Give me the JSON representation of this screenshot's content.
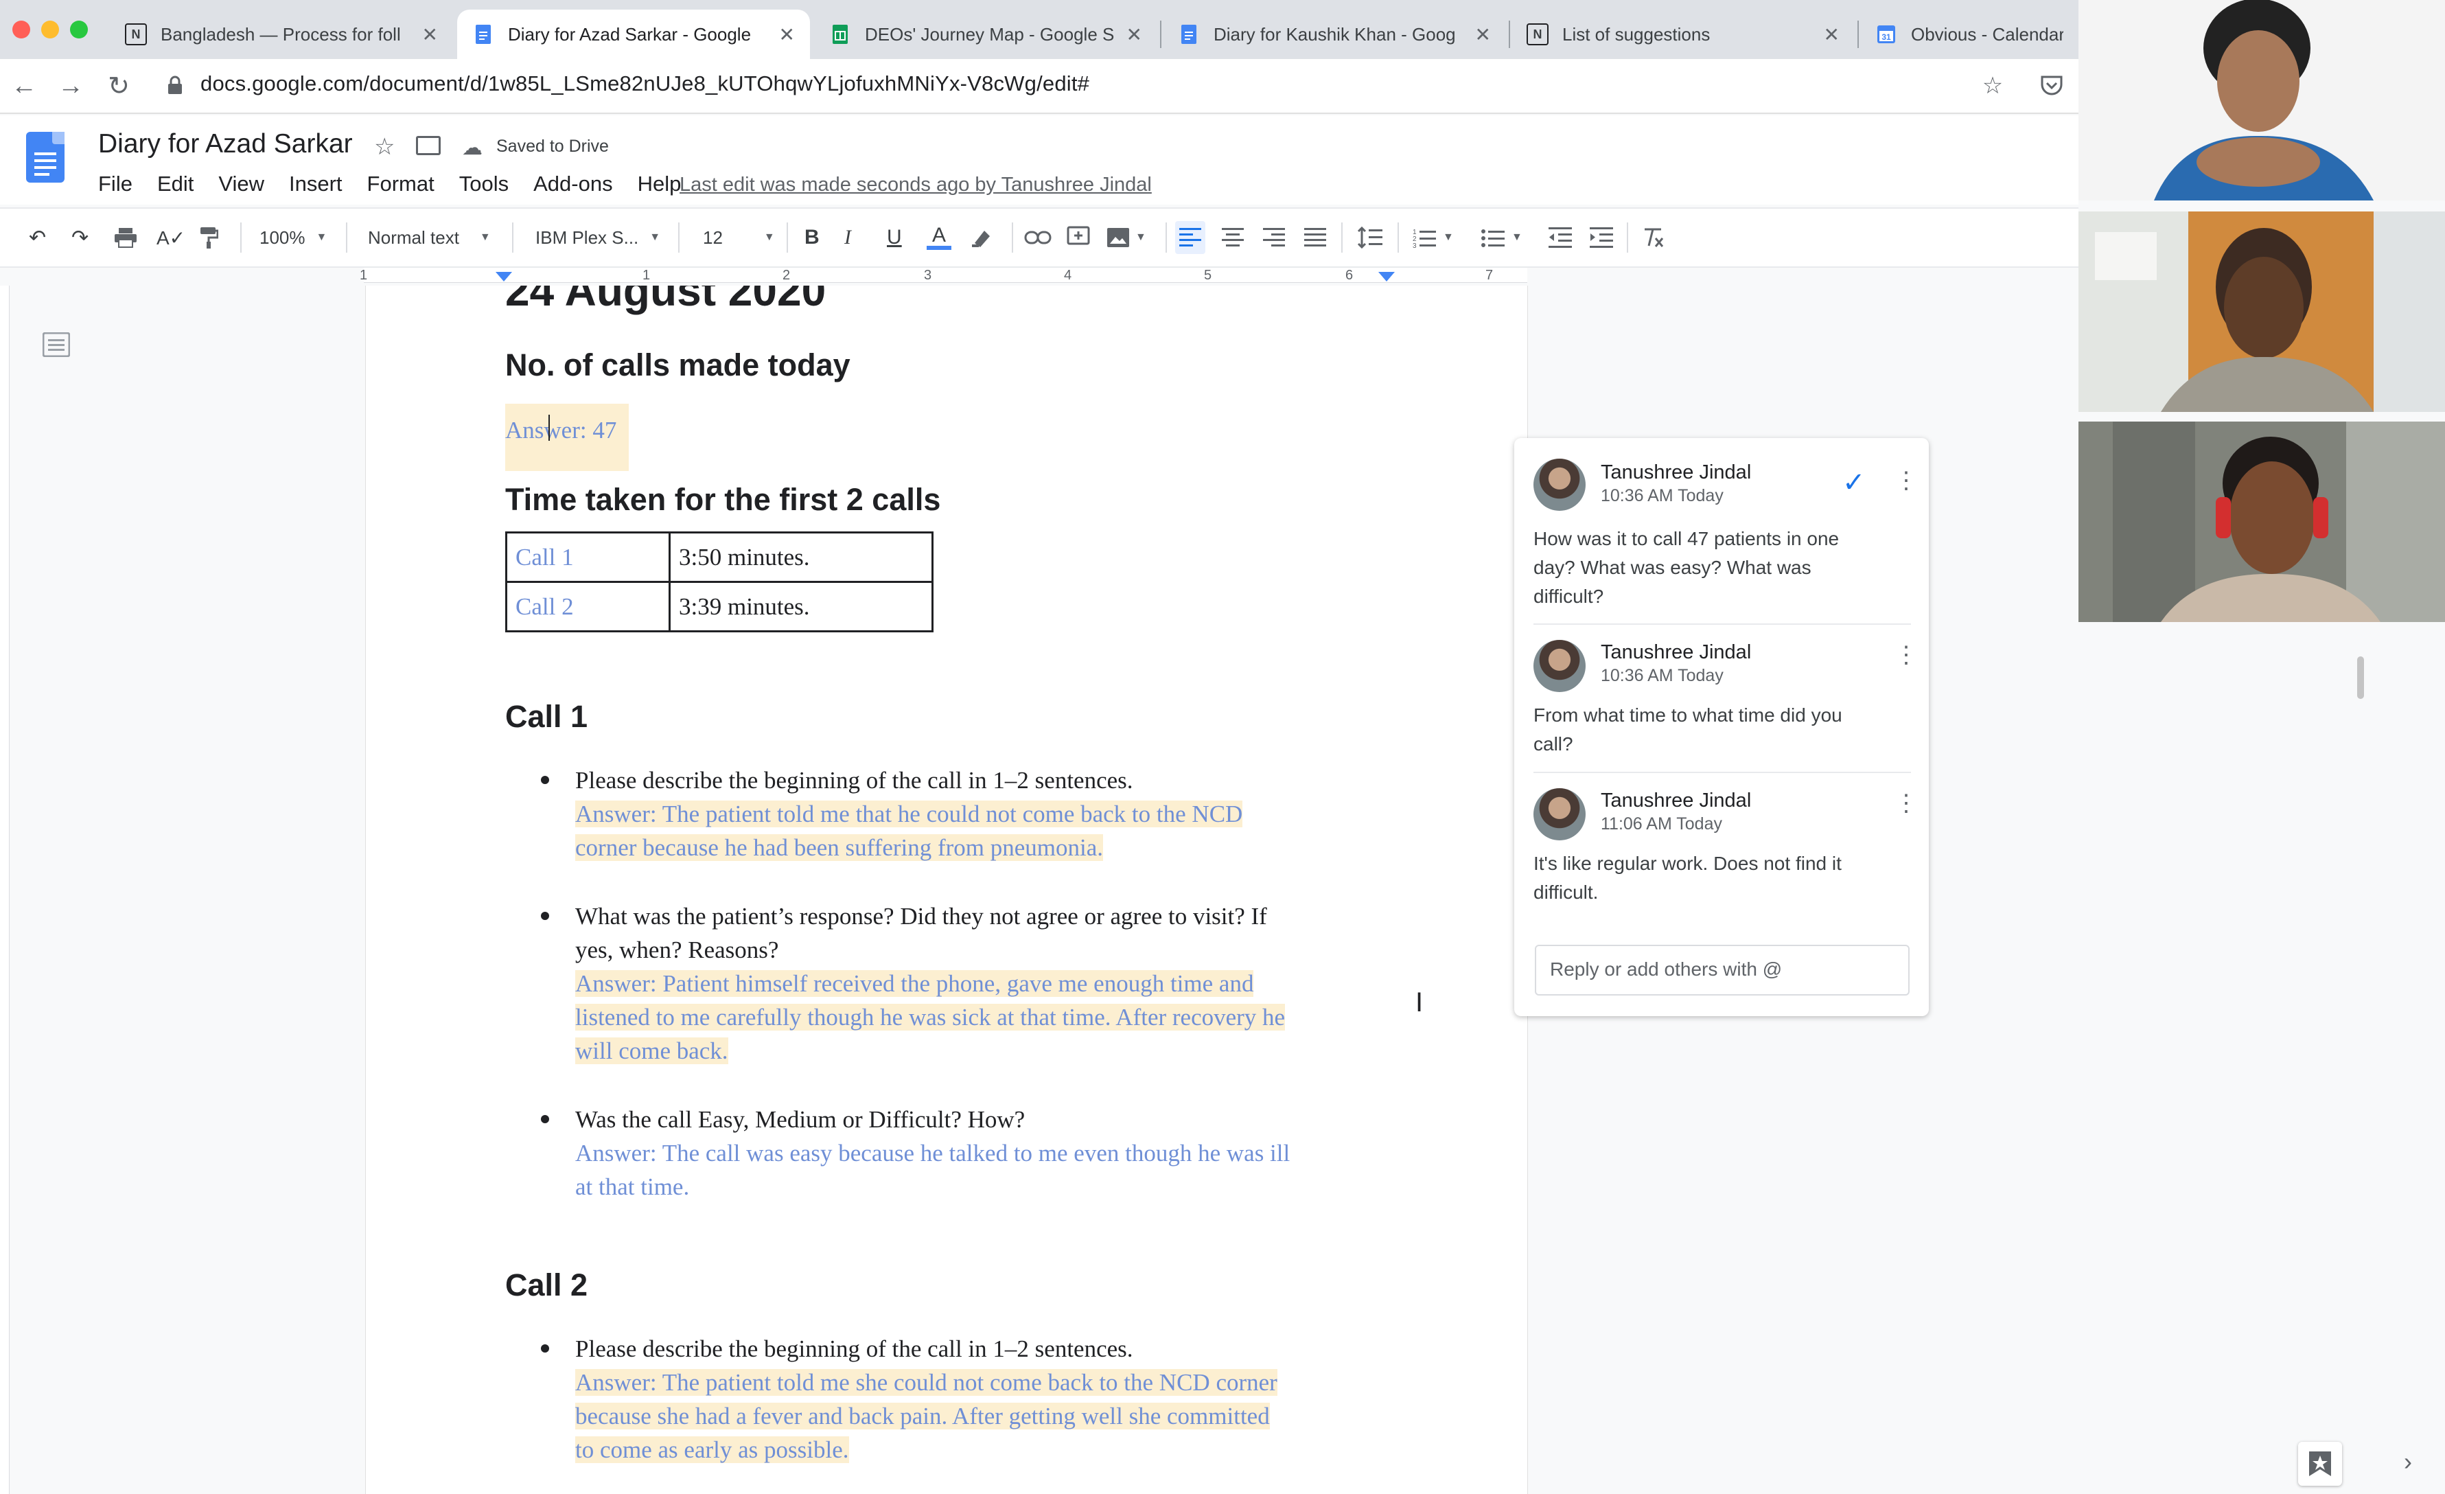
{
  "browser": {
    "tabs": [
      {
        "icon": "notion-icon",
        "title": "Bangladesh — Process for foll",
        "active": false
      },
      {
        "icon": "docs-icon",
        "title": "Diary for Azad Sarkar - Google",
        "active": true
      },
      {
        "icon": "sheets-icon",
        "title": "DEOs' Journey Map - Google S",
        "active": false
      },
      {
        "icon": "docs-icon",
        "title": "Diary for Kaushik Khan - Goog",
        "active": false
      },
      {
        "icon": "notion-icon",
        "title": "List of suggestions",
        "active": false
      },
      {
        "icon": "calendar-icon",
        "title": "Obvious - Calendar",
        "active": false
      }
    ],
    "close_glyph": "✕",
    "url": "docs.google.com/document/d/1w85L_LSme82nUJe8_kUTOhqwYLjofuxhMNiYx-V8cWg/edit#"
  },
  "docs": {
    "title": "Diary for Azad Sarkar",
    "saved_status": "Saved to Drive",
    "menu": [
      "File",
      "Edit",
      "View",
      "Insert",
      "Format",
      "Tools",
      "Add-ons",
      "Help"
    ],
    "last_edit": "Last edit was made seconds ago by Tanushree Jindal",
    "toolbar": {
      "zoom": "100%",
      "style": "Normal text",
      "font": "IBM Plex S...",
      "size": "12"
    },
    "ruler_numbers": [
      "1",
      "1",
      "2",
      "3",
      "4",
      "5",
      "6",
      "7"
    ]
  },
  "document": {
    "date_heading": "24 August 2020",
    "calls_heading": "No. of calls made today",
    "calls_answer": "Answer: 47",
    "time_heading": "Time taken for the first 2 calls",
    "time_table": [
      [
        "Call 1",
        "3:50 minutes."
      ],
      [
        "Call 2",
        "3:39 minutes."
      ]
    ],
    "call1": {
      "heading": "Call 1",
      "items": [
        {
          "q": "Please describe the beginning of the call in 1–2 sentences.",
          "a": [
            " Answer: The patient told me that he could not come back to the NCD",
            "corner because he had been suffering from pneumonia."
          ]
        },
        {
          "q": [
            "What was the patient’s response? Did they not agree or agree to visit? If",
            "yes, when? Reasons?"
          ],
          "a": [
            "Answer: Patient himself received the phone, gave me enough time and",
            "listened to me carefully though he was sick at that time. After recovery he",
            "will come back."
          ]
        },
        {
          "q": "Was the call Easy, Medium or Difficult? How?",
          "a": [
            "Answer: The call was easy because he talked to me even though he was ill",
            "at that time."
          ]
        }
      ]
    },
    "call2": {
      "heading": "Call 2",
      "items": [
        {
          "q": "Please describe the beginning of the call in 1–2 sentences.",
          "a": [
            " Answer: The patient told me she could not come back to the NCD corner",
            "because she had a fever and back pain. After getting  well she committed",
            "to come as early as possible."
          ]
        }
      ]
    }
  },
  "comments": {
    "thread": [
      {
        "author": "Tanushree Jindal",
        "time": "10:36 AM Today",
        "text": [
          "How was it to call 47 patients in one",
          "day? What was easy? What was",
          "difficult?"
        ]
      },
      {
        "author": "Tanushree Jindal",
        "time": "10:36 AM Today",
        "text": [
          "From what time to what time did you",
          "call?"
        ]
      },
      {
        "author": "Tanushree Jindal",
        "time": "11:06 AM Today",
        "text": [
          "It's like regular work. Does not find it",
          "difficult."
        ]
      }
    ],
    "reply_placeholder": "Reply or add others with @"
  },
  "colors": {
    "answer_text": "#6f8fd6",
    "highlight": "#fcefd1",
    "docs_blue": "#4285f4",
    "resolve_check": "#1a73e8"
  }
}
